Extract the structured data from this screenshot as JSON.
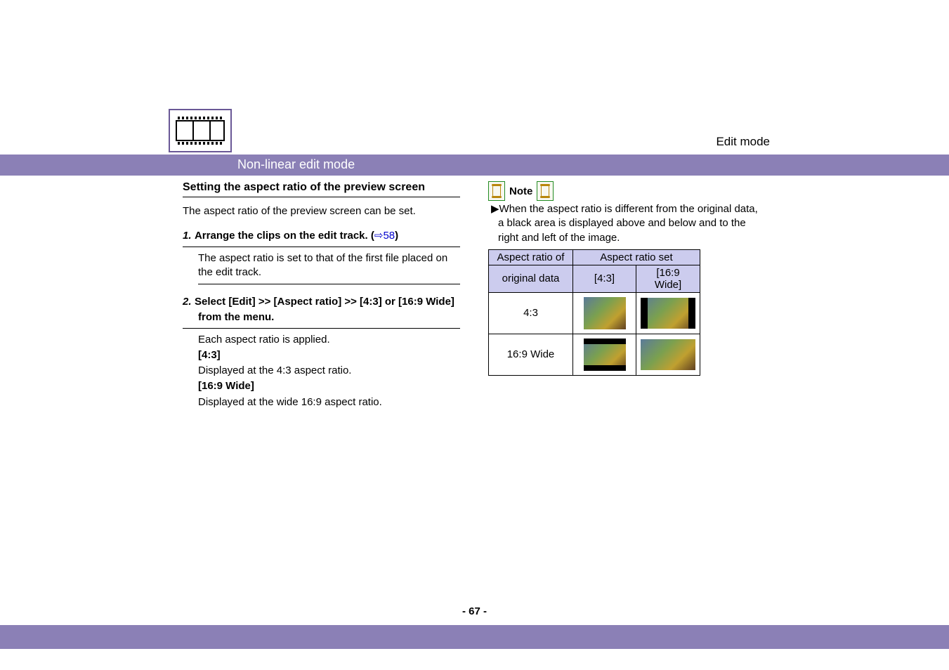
{
  "header": {
    "mode_label": "Edit mode",
    "band_label": "Non-linear edit mode"
  },
  "left": {
    "section_title": "Setting the aspect ratio of the preview screen",
    "intro": "The aspect ratio of the preview screen can be set.",
    "step1": {
      "num": "1.",
      "title": "Arrange the clips on the edit track. ",
      "link_open": "(",
      "link_arrow": "⇨",
      "link_num": "58",
      "link_close": ")",
      "desc": "The aspect ratio is set to that of the first file placed on the edit track."
    },
    "step2": {
      "num": "2.",
      "title": "Select [Edit] >> [Aspect ratio] >> [4:3] or [16:9 Wide] from the menu.",
      "desc_line1": "Each aspect ratio is applied.",
      "opt1_label": "[4:3]",
      "opt1_desc": "Displayed at the 4:3 aspect ratio.",
      "opt2_label": "[16:9 Wide]",
      "opt2_desc": "Displayed at the wide 16:9 aspect ratio."
    }
  },
  "right": {
    "note_label": "Note",
    "note_bullet": "▶",
    "note_text": "When the aspect ratio is different from the original data, a black area is displayed above and below and to the right and left of the image.",
    "table": {
      "col1_header": "Aspect ratio of original data",
      "col1_header_line1": "Aspect ratio of",
      "col1_header_line2": "original data",
      "col2_header": "Aspect ratio set",
      "sub1": "[4:3]",
      "sub2": "[16:9 Wide]",
      "row1_label": "4:3",
      "row2_label": "16:9 Wide"
    }
  },
  "footer": {
    "page": "- 67 -"
  },
  "icons": {
    "logo": "film-strip-icon",
    "note_can": "film-canister-icon"
  },
  "chart_data": {
    "type": "table",
    "title": "Aspect ratio display comparison",
    "columns": [
      "Aspect ratio of original data",
      "[4:3]",
      "[16:9 Wide]"
    ],
    "rows": [
      {
        "original": "4:3",
        "set_4_3": "full image (no bars)",
        "set_16_9_wide": "pillarboxed (black bars left/right)"
      },
      {
        "original": "16:9 Wide",
        "set_4_3": "letterboxed (black bars top/bottom)",
        "set_16_9_wide": "full image (no bars)"
      }
    ]
  }
}
